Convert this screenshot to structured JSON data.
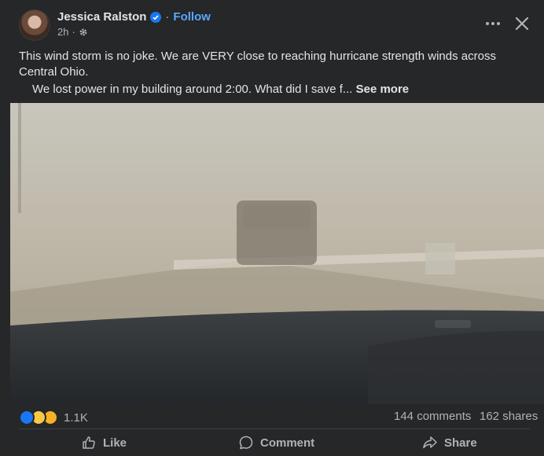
{
  "author": {
    "name": "Jessica Ralston",
    "follow": "Follow",
    "separator": "·",
    "time": "2h",
    "time_separator": "·"
  },
  "post": {
    "line1": "This wind storm is no joke. We are VERY close to reaching hurricane strength winds across Central Ohio.",
    "line2": "We lost power in my building around 2:00. What did I save f...",
    "see_more": "See more"
  },
  "media": {
    "description_icon": "dashcam-photo"
  },
  "stats": {
    "reactions_count": "1.1K",
    "comments": "144 comments",
    "shares": "162 shares"
  },
  "actions": {
    "like": "Like",
    "comment": "Comment",
    "share": "Share"
  },
  "colors": {
    "background": "#252728",
    "accent": "#5aa7ff",
    "like_blue": "#1877f2"
  }
}
